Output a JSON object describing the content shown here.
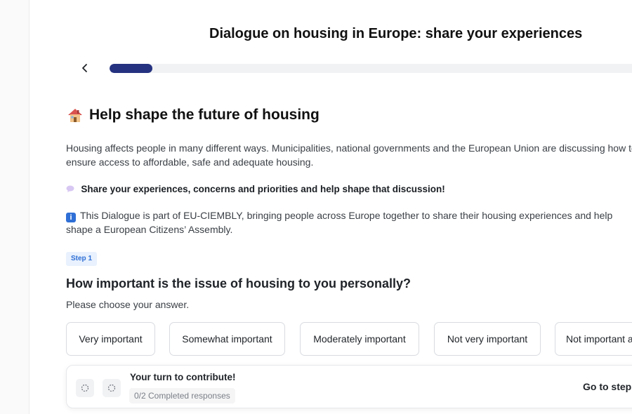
{
  "header": {
    "title": "Dialogue on housing in Europe: share your experiences",
    "progress_fraction": 0.08
  },
  "intro": {
    "heading_icon": "house-icon",
    "heading": "Help shape the future of housing",
    "paragraph_1": "Housing affects people in many different ways. Municipalities, national governments and the European Union are discussing how to ensure access to affordable, safe and adequate housing.",
    "speech_icon": "speech-bubble-icon",
    "paragraph_2": "Share your experiences, concerns and priorities and help shape that discussion!",
    "info_icon": "info-icon",
    "paragraph_3": "This Dialogue is part of EU-CIEMBLY, bringing people across Europe together to share their housing experiences and help shape a European Citizens’ Assembly."
  },
  "question": {
    "step_label": "Step 1",
    "title": "How important is the issue of housing to you personally?",
    "hint": "Please choose your answer.",
    "options": [
      "Very important",
      "Somewhat important",
      "Moderately important",
      "Not very important",
      "Not important at all"
    ]
  },
  "footer": {
    "turn_title": "Your turn to contribute!",
    "completed": "0/2 Completed responses",
    "go_to_step": "Go to step"
  },
  "colors": {
    "progress_fill": "#253280",
    "step_badge_text": "#2f6fd6",
    "step_badge_bg": "#e8f1fd"
  }
}
